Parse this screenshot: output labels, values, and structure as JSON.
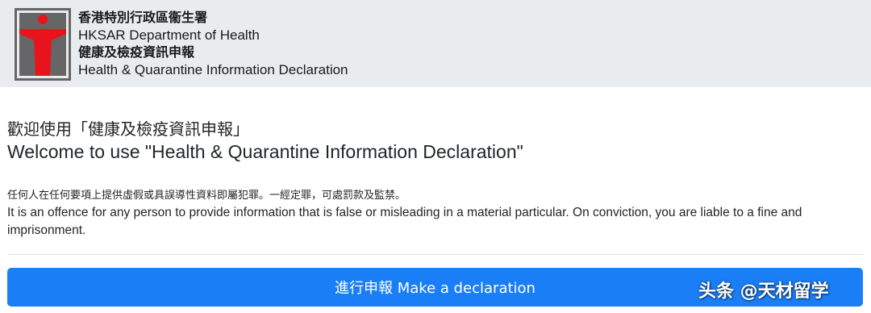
{
  "header": {
    "logo_icon": "dh-red-figure-logo",
    "colors": {
      "logo_red": "#e8141c",
      "logo_gray": "#666666",
      "bg": "#e9ecef"
    },
    "line1": "香港特別行政區衞生署",
    "line2": "HKSAR Department of Health",
    "line3": "健康及檢疫資訊申報",
    "line4": "Health & Quarantine Information Declaration"
  },
  "welcome": {
    "zh": "歡迎使用「健康及檢疫資訊申報」",
    "en": "Welcome to use \"Health & Quarantine Information Declaration\""
  },
  "warning": {
    "zh": "任何人在任何要項上提供虛假或具誤導性資料即屬犯罪。一經定罪，可處罰款及監禁。",
    "en": "It is an offence for any person to provide information that is false or misleading in a material particular. On conviction, you are liable to a fine and imprisonment."
  },
  "action": {
    "declare_label": "進行申報 Make a declaration",
    "color": "#1a7ff6"
  },
  "watermark": {
    "text": "头条 @天材留学"
  }
}
